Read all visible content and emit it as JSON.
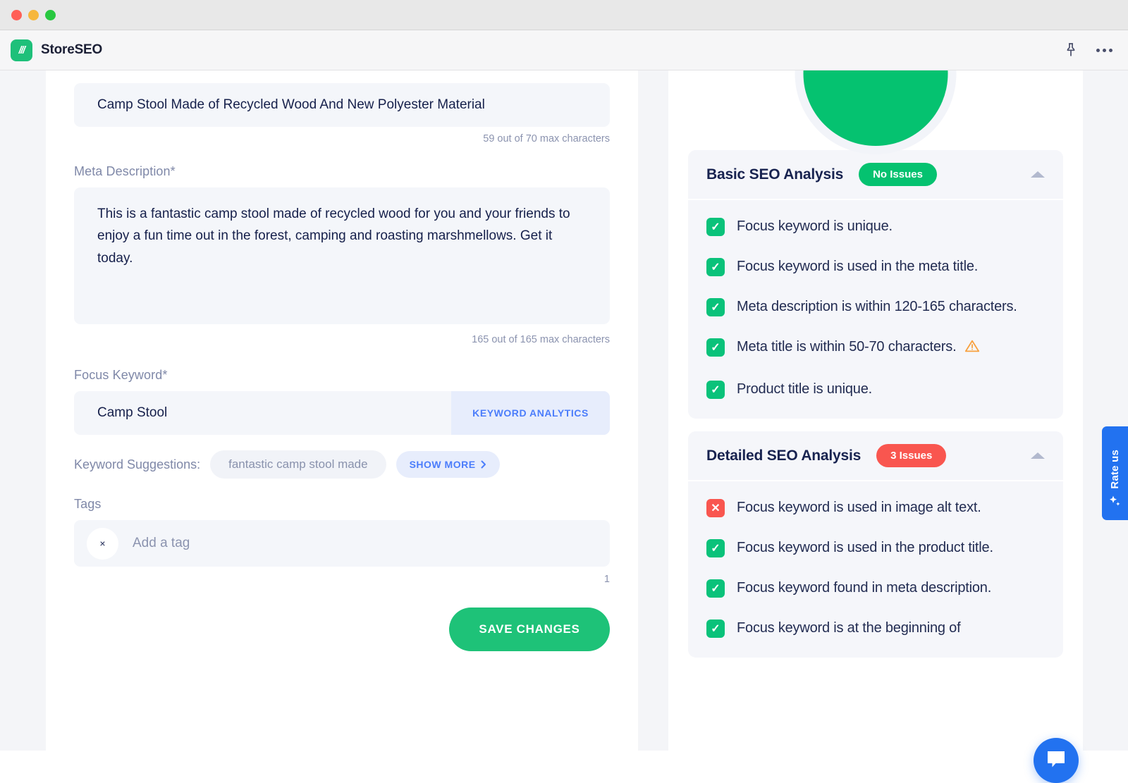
{
  "window": {
    "traffic_lights": [
      "close",
      "minimize",
      "maximize"
    ]
  },
  "topbar": {
    "brand_name": "StoreSEO",
    "logo_glyph": "///",
    "pin_icon": "pin-icon",
    "more_icon": "more-options-icon"
  },
  "editor": {
    "meta_title": {
      "value": "Camp Stool Made of Recycled Wood And New Polyester Material",
      "counter": "59 out of 70 max characters"
    },
    "meta_description": {
      "label": "Meta Description*",
      "value": "This is a fantastic camp stool made of recycled wood for you and your friends to enjoy a fun time out in the forest, camping and roasting marshmellows. Get it today.",
      "counter": "165 out of 165 max characters"
    },
    "focus_keyword": {
      "label": "Focus Keyword*",
      "value": "Camp Stool",
      "analytics_button": "KEYWORD ANALYTICS"
    },
    "suggestions": {
      "label": "Keyword Suggestions:",
      "chips": [
        "fantastic camp stool made"
      ],
      "show_more": "SHOW MORE",
      "show_more_chevron": "chevron-right-icon"
    },
    "tags": {
      "label": "Tags",
      "placeholder": "Add a tag",
      "remove_glyph": "×",
      "counter": "1"
    },
    "save_button": "SAVE CHANGES"
  },
  "analysis": {
    "score_ring_color": "#05c270",
    "sections": [
      {
        "title": "Basic SEO Analysis",
        "badge": "No Issues",
        "badge_color": "#05c270",
        "items": [
          {
            "status": "pass",
            "text": "Focus keyword is unique.",
            "warning": false
          },
          {
            "status": "pass",
            "text": "Focus keyword is used in the meta title.",
            "warning": false
          },
          {
            "status": "pass",
            "text": "Meta description is within 120-165 characters.",
            "warning": false
          },
          {
            "status": "pass",
            "text": "Meta title is within 50-70 characters.",
            "warning": true
          },
          {
            "status": "pass",
            "text": "Product title is unique.",
            "warning": false
          }
        ]
      },
      {
        "title": "Detailed SEO Analysis",
        "badge": "3 Issues",
        "badge_color": "#f9564f",
        "items": [
          {
            "status": "fail",
            "text": "Focus keyword is used in image alt text.",
            "warning": false
          },
          {
            "status": "pass",
            "text": "Focus keyword is used in the product title.",
            "warning": false
          },
          {
            "status": "pass",
            "text": "Focus keyword found in meta description.",
            "warning": false
          },
          {
            "status": "pass",
            "text": "Focus keyword is at the beginning of",
            "warning": false
          }
        ]
      }
    ]
  },
  "widgets": {
    "rate_us_label": "Rate us",
    "rate_us_icon": "sparkles-icon",
    "chat_icon": "chat-bubble-icon"
  }
}
